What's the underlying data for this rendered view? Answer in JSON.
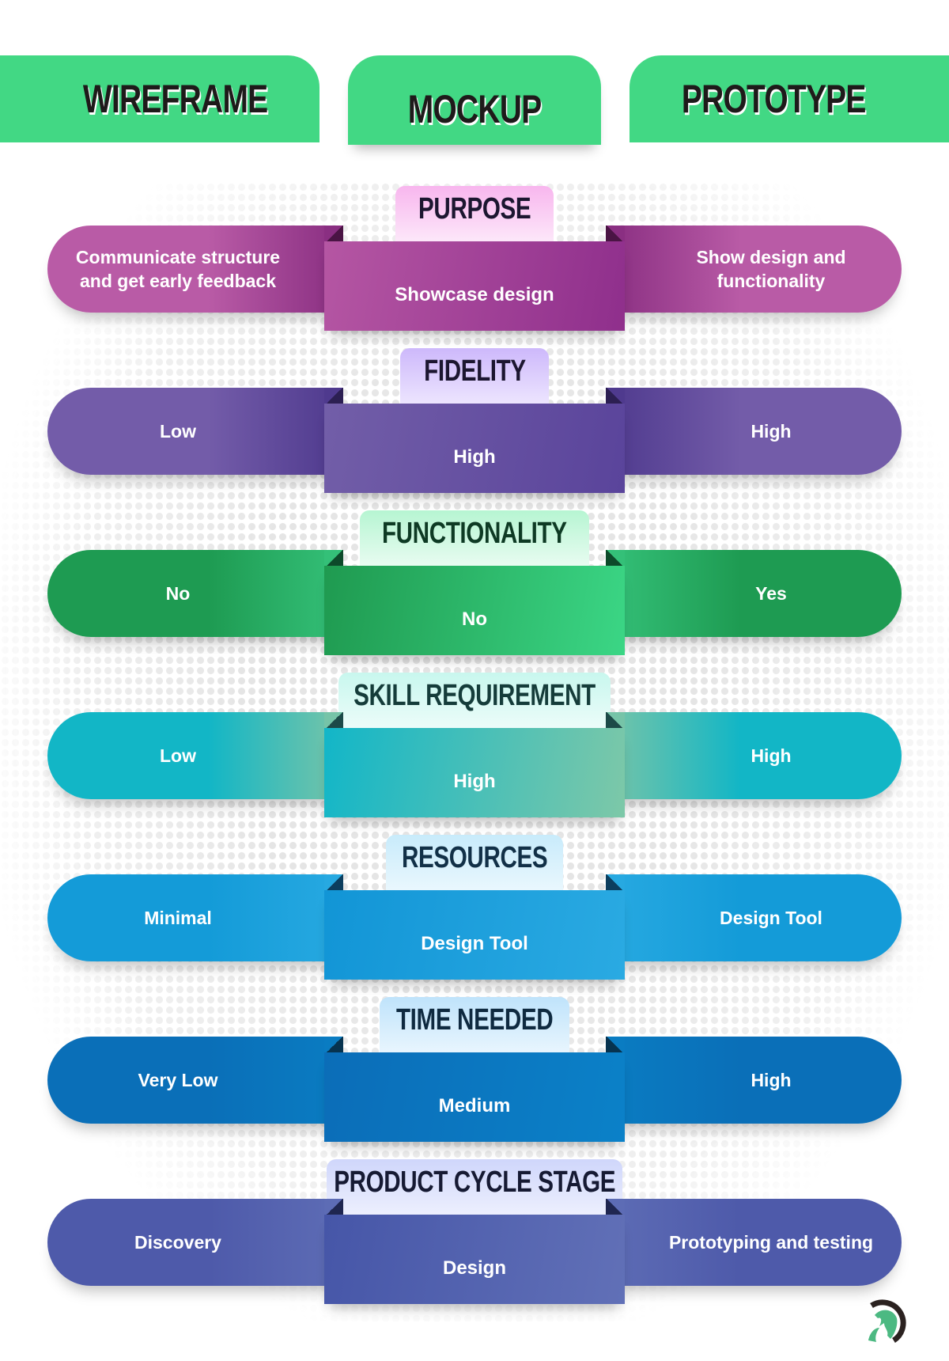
{
  "headers": {
    "wireframe": "WIREFRAME",
    "mockup": "MOCKUP",
    "prototype": "PROTOTYPE",
    "color": "#42d884"
  },
  "rows": [
    {
      "label": "PURPOSE",
      "wireframe": "Communicate structure and get early feedback",
      "mockup": "Showcase design",
      "prototype": "Show design and functionality",
      "colors": {
        "tab_top": "#f8b6ee",
        "tab_bottom": "#fdeefb",
        "tab_text": "#1c1630",
        "side_outer": "#b95ba6",
        "side_inner": "#8a2f82",
        "fold": "#4a1444",
        "mid_start": "#b556a3",
        "mid_end": "#8f2f8c"
      }
    },
    {
      "label": "FIDELITY",
      "wireframe": "Low",
      "mockup": "High",
      "prototype": "High",
      "colors": {
        "tab_top": "#cdb8fb",
        "tab_bottom": "#f1ebff",
        "tab_text": "#1c1630",
        "side_outer": "#735ca9",
        "side_inner": "#4f3a8e",
        "fold": "#2c1f52",
        "mid_start": "#725ea8",
        "mid_end": "#5a449b"
      }
    },
    {
      "label": "FUNCTIONALITY",
      "wireframe": "No",
      "mockup": "No",
      "prototype": "Yes",
      "colors": {
        "tab_top": "#b6f5d2",
        "tab_bottom": "#effdf5",
        "tab_text": "#0e3a24",
        "side_outer": "#1e9b52",
        "side_inner": "#34c078",
        "fold": "#0d4a2a",
        "mid_start": "#1f9a50",
        "mid_end": "#3bd685"
      }
    },
    {
      "label": "SKILL REQUIREMENT",
      "wireframe": "Low",
      "mockup": "High",
      "prototype": "High",
      "colors": {
        "tab_top": "#c8f7ee",
        "tab_bottom": "#f1fdfb",
        "tab_text": "#153c3a",
        "side_outer": "#12b6c6",
        "side_inner": "#76c4a8",
        "fold": "#1c4a48",
        "mid_start": "#12b6c8",
        "mid_end": "#7dc8a8"
      }
    },
    {
      "label": "RESOURCES",
      "wireframe": "Minimal",
      "mockup": "Design Tool",
      "prototype": "Design Tool",
      "colors": {
        "tab_top": "#c8ebfb",
        "tab_bottom": "#eef9fe",
        "tab_text": "#123047",
        "side_outer": "#149bd8",
        "side_inner": "#27a9e1",
        "fold": "#0c3e5e",
        "mid_start": "#1295d6",
        "mid_end": "#2aaae2"
      }
    },
    {
      "label": "TIME NEEDED",
      "wireframe": "Very Low",
      "mockup": "Medium",
      "prototype": "High",
      "colors": {
        "tab_top": "#bfe3fb",
        "tab_bottom": "#eef8fe",
        "tab_text": "#0f2a40",
        "side_outer": "#0a6fb8",
        "side_inner": "#0a7cc2",
        "fold": "#07334f",
        "mid_start": "#0b6db8",
        "mid_end": "#0b81c8"
      }
    },
    {
      "label": "PRODUCT CYCLE STAGE",
      "wireframe": "Discovery",
      "mockup": "Design",
      "prototype": "Prototyping and testing",
      "colors": {
        "tab_top": "#cfd6fb",
        "tab_bottom": "#f1f3fe",
        "tab_text": "#161a33",
        "side_outer": "#4e5aaa",
        "side_inner": "#5d6cb5",
        "fold": "#1f2650",
        "mid_start": "#4656a8",
        "mid_end": "#6170b7"
      }
    }
  ],
  "logo": {
    "icon": "spartan-helmet-icon",
    "primary": "#4cb982",
    "secondary": "#2b2220"
  }
}
